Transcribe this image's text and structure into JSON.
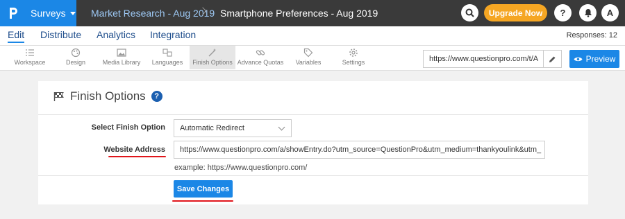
{
  "topbar": {
    "product": "Surveys",
    "breadcrumb_folder": "Market Research - Aug 2019",
    "breadcrumb_survey": "Smartphone Preferences - Aug 2019",
    "upgrade_label": "Upgrade Now",
    "help_glyph": "?",
    "avatar_initial": "A"
  },
  "main_tabs": [
    "Edit",
    "Distribute",
    "Analytics",
    "Integration"
  ],
  "responses": "Responses: 12",
  "toolbar": {
    "items": [
      "Workspace",
      "Design",
      "Media Library",
      "Languages",
      "Finish Options",
      "Advance Quotas",
      "Variables",
      "Settings"
    ],
    "active_item": "Finish Options",
    "url": "https://www.questionpro.com/t/A",
    "preview_label": "Preview"
  },
  "panel": {
    "title": "Finish Options",
    "finish_option_label": "Select Finish Option",
    "finish_option_value": "Automatic Redirect",
    "website_label": "Website Address",
    "website_value": "https://www.questionpro.com/a/showEntry.do?utm_source=QuestionPro&utm_medium=thankyoulink&utm_",
    "example": "example: https://www.questionpro.com/",
    "save_label": "Save Changes"
  },
  "colors": {
    "accent": "#1b87e6",
    "topbar": "#3a3a3a",
    "upgrade": "#f5a623",
    "annotation": "#e0151b"
  }
}
